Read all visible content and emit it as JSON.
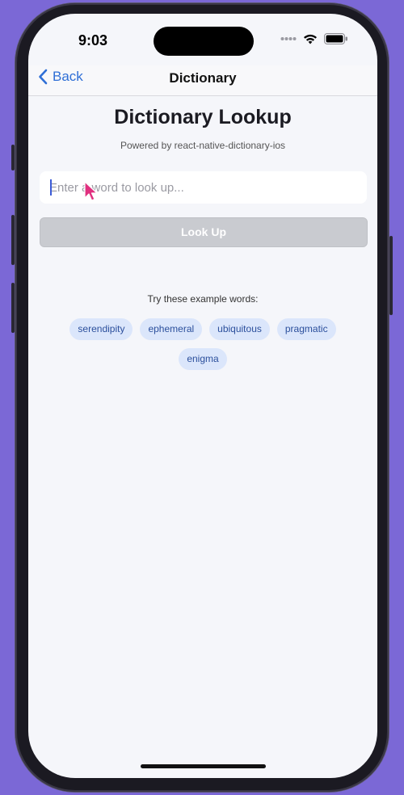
{
  "status_bar": {
    "time": "9:03"
  },
  "nav": {
    "back_label": "Back",
    "title": "Dictionary"
  },
  "main": {
    "heading": "Dictionary Lookup",
    "subheading": "Powered by react-native-dictionary-ios",
    "search": {
      "placeholder": "Enter a word to look up...",
      "value": ""
    },
    "lookup_button": "Look Up",
    "examples_label": "Try these example words:",
    "example_words": [
      "serendipity",
      "ephemeral",
      "ubiquitous",
      "pragmatic",
      "enigma"
    ]
  },
  "colors": {
    "accent": "#2f6fd6",
    "chip_bg": "#dbe6fb",
    "chip_text": "#2b4f9c",
    "disabled_button": "#c9cbd0",
    "background": "#f5f6fa"
  },
  "icons": {
    "back": "chevron-left-icon",
    "signal": "cellular-signal-icon",
    "wifi": "wifi-icon",
    "battery": "battery-icon",
    "cursor": "mouse-pointer-icon"
  }
}
